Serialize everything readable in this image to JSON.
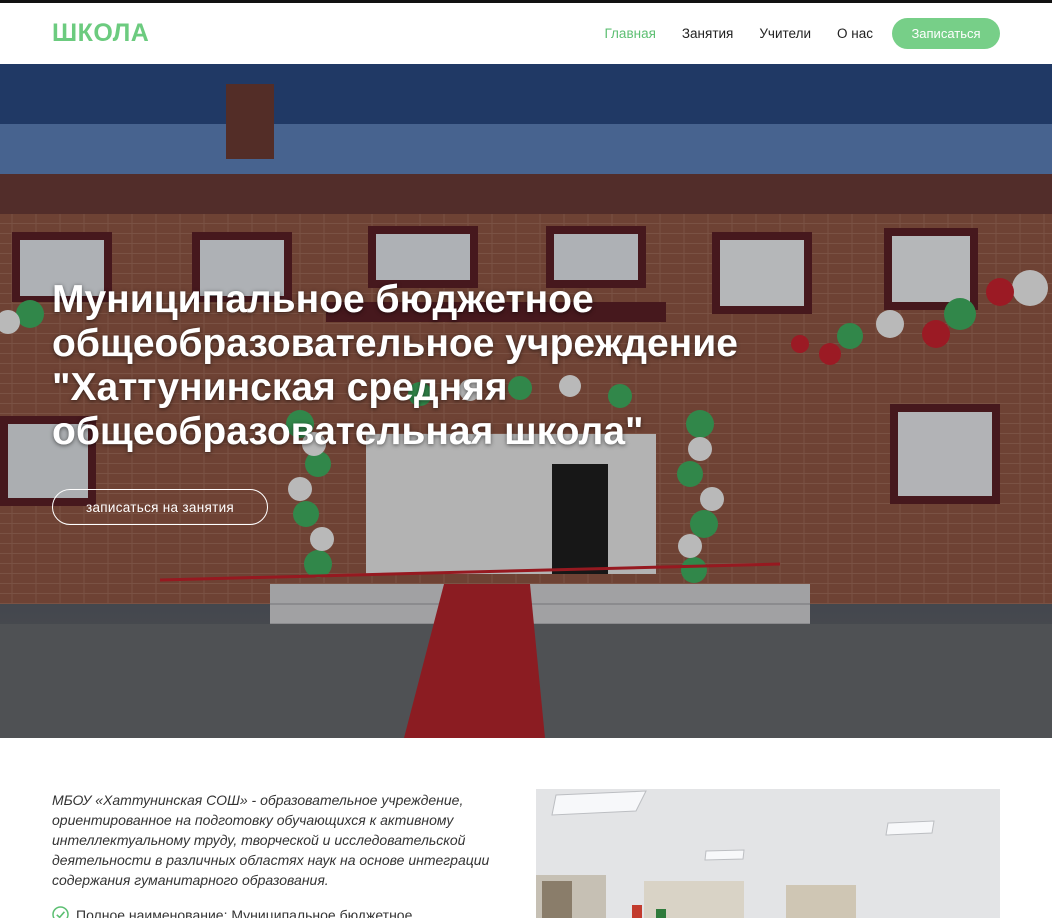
{
  "nav": {
    "logo": "ШКОЛА",
    "items": [
      {
        "label": "Главная",
        "active": true
      },
      {
        "label": "Занятия",
        "active": false
      },
      {
        "label": "Учители",
        "active": false
      },
      {
        "label": "О нас",
        "active": false
      }
    ],
    "cta_label": "Записаться"
  },
  "hero": {
    "title": "Муниципальное бюджетное общеобразовательное учреждение \"Хаттунинская средняя общеобразовательная школа\"",
    "button_label": "записаться на занятия"
  },
  "about": {
    "description": "МБОУ «Хаттунинская СОШ» - образовательное учреждение, ориентированное на подготовку обучающихся к активному интеллектуальному труду, творческой и исследовательской деятельности в различных областях наук на основе интеграции содержания гуманитарного образования.",
    "list_item": "Полное наименование: Муниципальное бюджетное"
  },
  "colors": {
    "accent": "#77cf88",
    "logo": "#6ccb7f",
    "active_link": "#5cbf72"
  },
  "icons": {
    "list_bullet": "check-circle-icon"
  }
}
